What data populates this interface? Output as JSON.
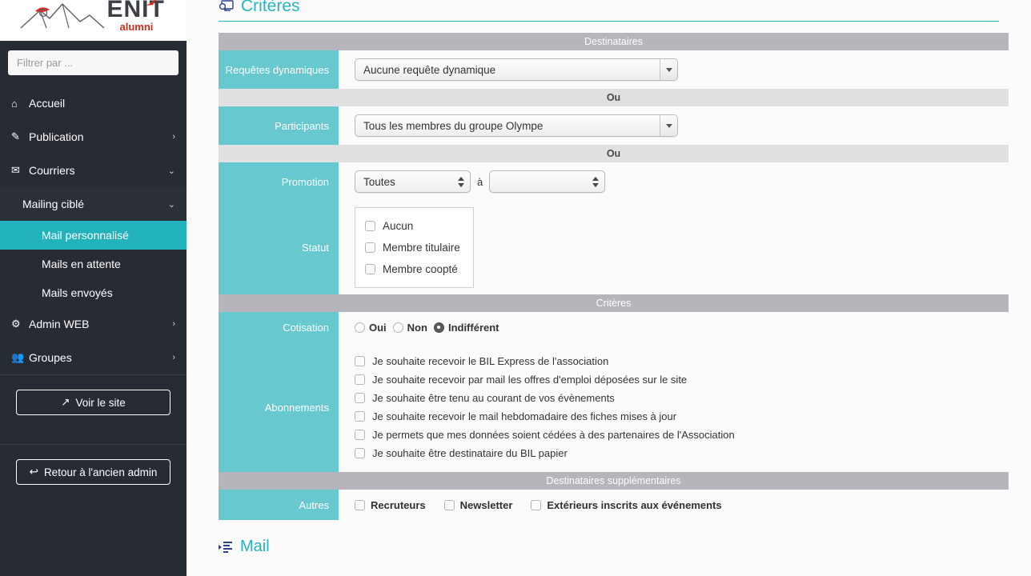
{
  "sidebar": {
    "logo": {
      "brand": "ENIT",
      "sub": "alumni",
      "mountain_icon": "mountain-logo-icon"
    },
    "filter": {
      "placeholder": "Filtrer par ...",
      "value": ""
    },
    "items": [
      {
        "label": "Accueil",
        "icon": "home-icon",
        "level": 1,
        "chevron": "",
        "active": false
      },
      {
        "label": "Publication",
        "icon": "edit-icon",
        "level": 1,
        "chevron": "›",
        "active": false
      },
      {
        "label": "Courriers",
        "icon": "envelope-icon",
        "level": 1,
        "chevron": "⌄",
        "active": false
      },
      {
        "label": "Mailing ciblé",
        "icon": "",
        "level": 2,
        "chevron": "⌄",
        "active": false
      },
      {
        "label": "Mail personnalisé",
        "icon": "",
        "level": 3,
        "chevron": "",
        "active": true
      },
      {
        "label": "Mails en attente",
        "icon": "",
        "level": 3,
        "chevron": "",
        "active": false
      },
      {
        "label": "Mails envoyés",
        "icon": "",
        "level": 3,
        "chevron": "",
        "active": false
      },
      {
        "label": "Admin WEB",
        "icon": "gear-icon",
        "level": 1,
        "chevron": "›",
        "active": false
      },
      {
        "label": "Groupes",
        "icon": "users-icon",
        "level": 1,
        "chevron": "›",
        "active": false
      }
    ],
    "view_site_button": "Voir le site",
    "view_site_icon": "external-link-icon",
    "back_admin_button": "Retour à l'ancien admin",
    "back_admin_icon": "arrow-back-icon",
    "accent_color": "#21b2bb",
    "background_color": "#272b33"
  },
  "main": {
    "page_title": "Critères",
    "page_title_icon": "criteria-screen-icon",
    "mail_section_title": "Mail",
    "mail_section_icon": "mail-compose-icon",
    "accent_color": "#27b4c2",
    "label_color": "#67c8d0",
    "bar_color": "#b5b5bb",
    "subbar_color": "#e0e0e0",
    "bars": {
      "destinataires": "Destinataires",
      "ou_1": "Ou",
      "ou_2": "Ou",
      "criteres": "Critères",
      "destinataires_supp": "Destinataires supplémentaires"
    },
    "rows": {
      "requetes": {
        "label": "Requêtes dynamiques",
        "value": "Aucune requête dynamique"
      },
      "participants": {
        "label": "Participants",
        "value": "Tous les membres du groupe Olympe"
      },
      "promotion": {
        "label": "Promotion",
        "from_value": "Toutes",
        "between": "à",
        "to_value": ""
      },
      "statut": {
        "label": "Statut",
        "options": [
          {
            "label": "Aucun",
            "checked": false
          },
          {
            "label": "Membre titulaire",
            "checked": false
          },
          {
            "label": "Membre coopté",
            "checked": false
          }
        ]
      },
      "cotisation": {
        "label": "Cotisation",
        "options": [
          {
            "label": "Oui",
            "checked": false
          },
          {
            "label": "Non",
            "checked": false
          },
          {
            "label": "Indifférent",
            "checked": true
          }
        ]
      },
      "abonnements": {
        "label": "Abonnements",
        "options": [
          {
            "label": "Je souhaite recevoir le BIL Express de l'association",
            "checked": false
          },
          {
            "label": "Je souhaite recevoir par mail les offres d'emploi déposées sur le site",
            "checked": false
          },
          {
            "label": "Je souhaite être tenu au courant de vos évènements",
            "checked": false
          },
          {
            "label": "Je souhaite recevoir le mail hebdomadaire des fiches mises à jour",
            "checked": false
          },
          {
            "label": "Je permets que mes données soient cédées à des partenaires de l'Association",
            "checked": false
          },
          {
            "label": "Je souhaite être destinataire du BIL papier",
            "checked": false
          }
        ]
      },
      "autres": {
        "label": "Autres",
        "options": [
          {
            "label": "Recruteurs",
            "checked": false
          },
          {
            "label": "Newsletter",
            "checked": false
          },
          {
            "label": "Extérieurs inscrits aux événements",
            "checked": false
          }
        ]
      }
    }
  }
}
